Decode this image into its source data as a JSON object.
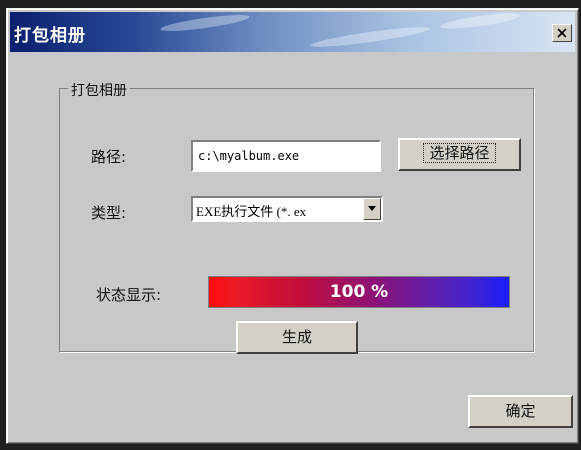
{
  "window": {
    "title": "打包相册"
  },
  "group": {
    "label": "打包相册"
  },
  "path": {
    "label": "路径:",
    "value": "c:\\myalbum.exe",
    "browse_button": "选择路径"
  },
  "type": {
    "label": "类型:",
    "selected": "EXE执行文件 (*. ex"
  },
  "status": {
    "label": "状态显示:",
    "progress_text": "100 %",
    "progress_fraction": 1.0
  },
  "buttons": {
    "generate": "生成",
    "ok": "确定"
  },
  "colors": {
    "title_start": "#0a1f6e",
    "progress_start": "#ff0b0b",
    "progress_end": "#1a1cff",
    "window_bg": "#c8c8c8"
  }
}
